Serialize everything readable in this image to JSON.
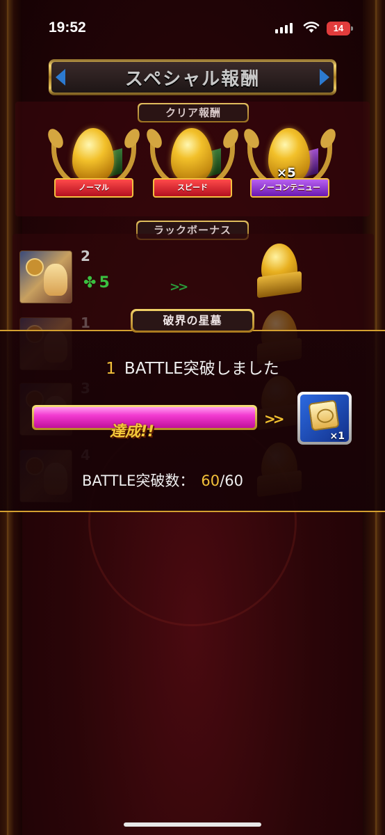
{
  "status_bar": {
    "time": "19:52",
    "battery": "14"
  },
  "title": "スペシャル報酬",
  "clear_rewards": {
    "label": "クリア報酬",
    "items": [
      {
        "ribbon": "ノーマル",
        "color": "#d01c2c"
      },
      {
        "ribbon": "スピード",
        "color": "#d01c2c"
      },
      {
        "ribbon": "ノーコンテニュー",
        "color": "#8a2ad0",
        "multiplier": "×5"
      }
    ]
  },
  "luck_bonus": {
    "label": "ラックボーナス",
    "rows": [
      {
        "rank": "2",
        "luck": "5",
        "arrow": ">>"
      },
      {
        "rank": "1"
      },
      {
        "rank": "3"
      },
      {
        "rank": "4"
      }
    ]
  },
  "dialog": {
    "title": "破界の星墓",
    "battle_num": "1",
    "battle_text": "BATTLE突破しました",
    "progress_label": "達成!!",
    "progress_fraction": 1.0,
    "arrow": ">>",
    "reward_qty": "×1",
    "count_label": "BATTLE突破数：",
    "count_current": "60",
    "count_total": "/60"
  },
  "colors": {
    "accent_gold": "#d4a030",
    "progress_pink": "#f03ad0",
    "highlight_yellow": "#f3c13a"
  }
}
